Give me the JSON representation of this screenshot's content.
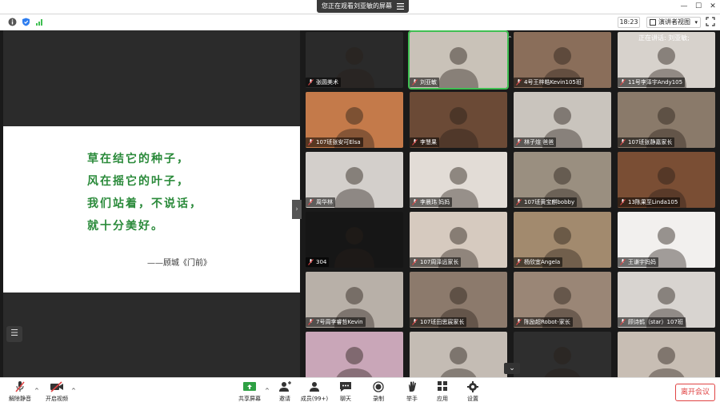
{
  "title_bar": {
    "screen_notice": "您正在观看刘亚敏的屏幕",
    "controls": [
      "—",
      "☐",
      "✕"
    ]
  },
  "top_toolbar": {
    "clock": "18:23",
    "view_mode": "演讲者视图",
    "icons": [
      "info-icon",
      "shield-icon",
      "signal-icon"
    ]
  },
  "shared_slide": {
    "poem_lines": [
      "草在结它的种子，",
      "风在摇它的叶子，",
      "我们站着，不说话，",
      "就十分美好。"
    ],
    "author": "——顾城《门前》"
  },
  "gallery": {
    "speaking_now": "正在讲话: 刘亚敏;",
    "tiles": [
      {
        "name": "张圆美术",
        "bg": "#2a2a2a"
      },
      {
        "name": "刘亚敏",
        "bg": "#c9c2b8",
        "active": true
      },
      {
        "name": "4号王梓皓Kevin105班",
        "bg": "#8a6e5a"
      },
      {
        "name": "11号李泽宇Andy105",
        "bg": "#d7d2cc"
      },
      {
        "name": "107班张安可Elsa",
        "bg": "#c47a4a"
      },
      {
        "name": "李慧果",
        "bg": "#6b4a36"
      },
      {
        "name": "林子煊 爸爸",
        "bg": "#c9c4bd"
      },
      {
        "name": "107班张静嘉家长",
        "bg": "#8a7a6a"
      },
      {
        "name": "周华林",
        "bg": "#d3cfcb"
      },
      {
        "name": "李晨玮 妈妈",
        "bg": "#e2dcd6"
      },
      {
        "name": "107班黄宝麒bobby",
        "bg": "#9a8f80"
      },
      {
        "name": "13陈果至Linda105",
        "bg": "#7a4e34"
      },
      {
        "name": "304",
        "bg": "#161616"
      },
      {
        "name": "107周泽远家长",
        "bg": "#d6cabf"
      },
      {
        "name": "杨欣宜Angela",
        "bg": "#a28a6e"
      },
      {
        "name": "王谦宇妈妈",
        "bg": "#f2f0ee"
      },
      {
        "name": "7号周李睿哲Kevin",
        "bg": "#b8b0a8"
      },
      {
        "name": "107班田思宸家长",
        "bg": "#8c7a6c"
      },
      {
        "name": "陈励超Robot-家长",
        "bg": "#9a8676"
      },
      {
        "name": "顾诗鹤（star）107班",
        "bg": "#d8d4d0"
      },
      {
        "name": "",
        "bg": "#c9a6b8"
      },
      {
        "name": "",
        "bg": "#c4bcb4"
      },
      {
        "name": "",
        "bg": "#2e2e2e"
      },
      {
        "name": "",
        "bg": "#c8beb4"
      }
    ]
  },
  "bottom_toolbar": {
    "mute": "解除静音",
    "video": "开启视频",
    "share": "共享屏幕",
    "invite": "邀请",
    "members": "成员(99+)",
    "chat": "聊天",
    "record": "录制",
    "raise_hand": "举手",
    "apps": "应用",
    "settings": "设置",
    "leave": "离开会议"
  },
  "colors": {
    "poem_green": "#2a8a3a",
    "active_border": "#3fbf52",
    "leave_red": "#e04444"
  }
}
